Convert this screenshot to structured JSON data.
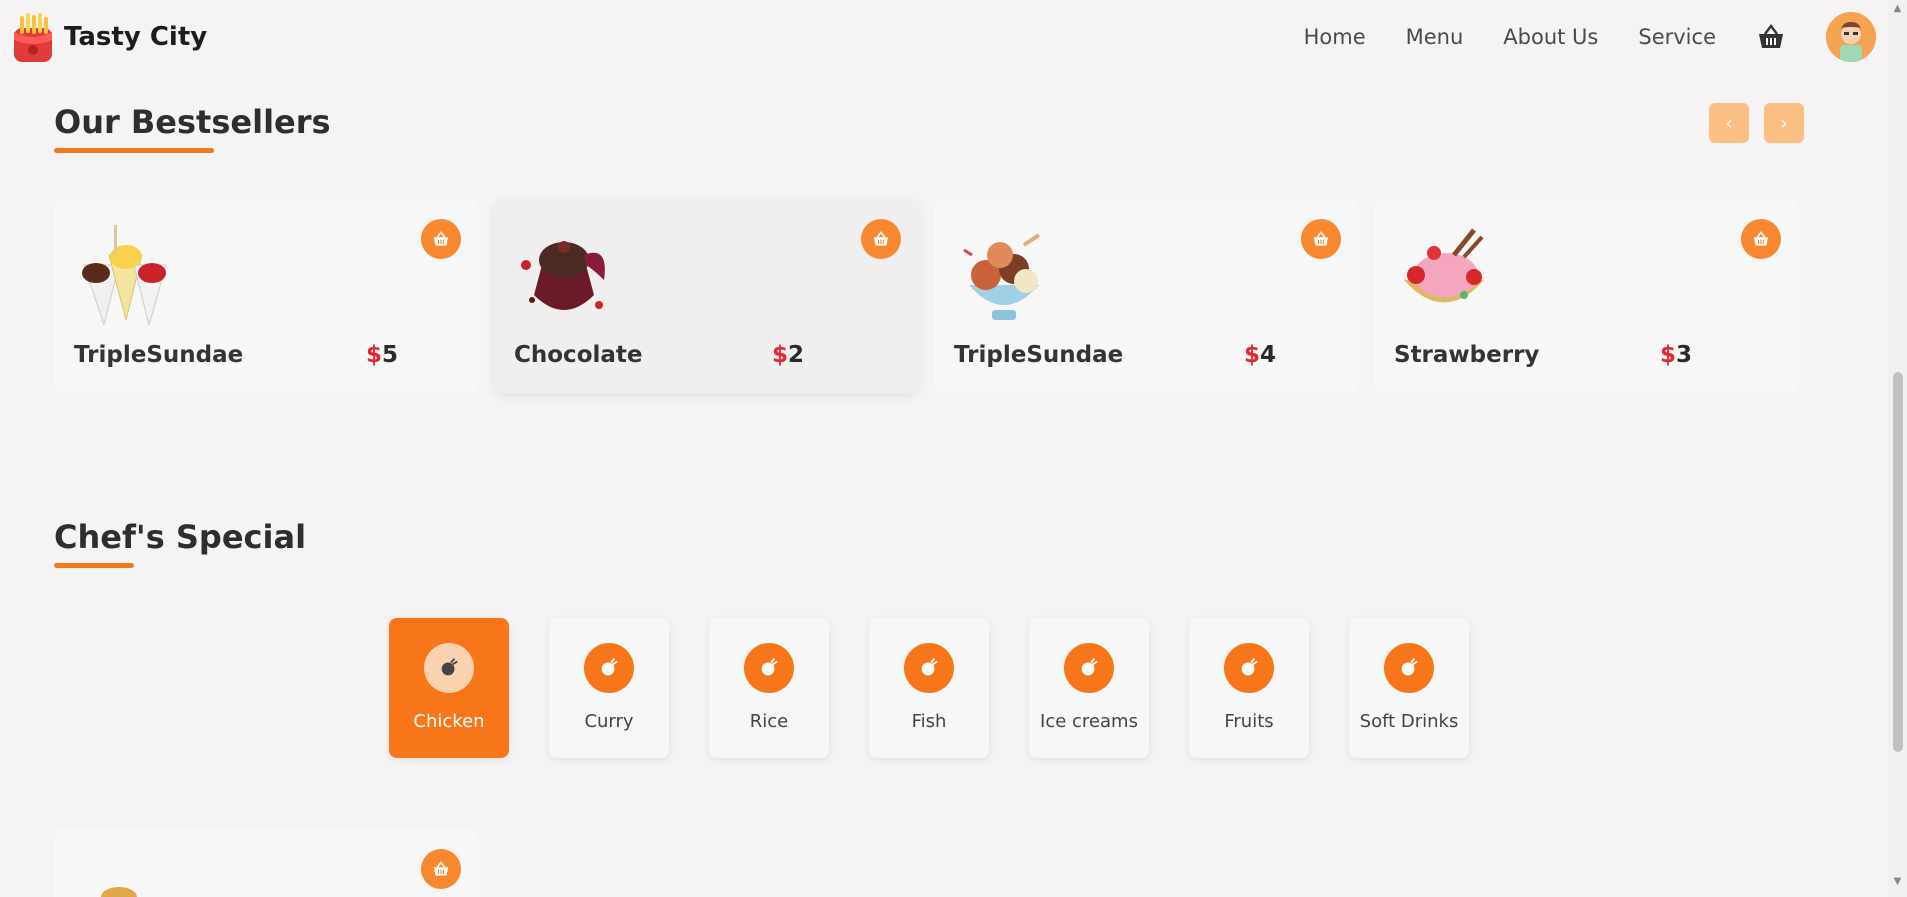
{
  "brand": {
    "name": "Tasty City"
  },
  "nav": {
    "items": [
      "Home",
      "Menu",
      "About Us",
      "Service"
    ]
  },
  "bestsellers": {
    "title": "Our Bestsellers",
    "prev_label": "‹",
    "next_label": "›",
    "items": [
      {
        "name": "TripleSundae",
        "currency": "$",
        "price": "5"
      },
      {
        "name": "Chocolate",
        "currency": "$",
        "price": "2"
      },
      {
        "name": "TripleSundae",
        "currency": "$",
        "price": "4"
      },
      {
        "name": "Strawberry",
        "currency": "$",
        "price": "3"
      }
    ]
  },
  "chefs_special": {
    "title": "Chef's Special",
    "categories": [
      "Chicken",
      "Curry",
      "Rice",
      "Fish",
      "Ice creams",
      "Fruits",
      "Soft Drinks"
    ],
    "active_category": "Chicken"
  },
  "colors": {
    "accent": "#f67619",
    "price_currency": "#e3262f",
    "slider_button": "#fbbf84"
  },
  "icons": {
    "cart": "basket-icon",
    "add": "basket-icon",
    "category": "food-icon"
  }
}
